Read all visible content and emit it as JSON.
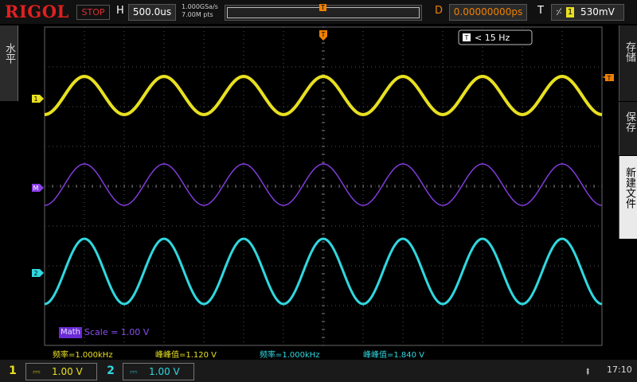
{
  "top": {
    "logo": "RIGOL",
    "run_state": "STOP",
    "h_label": "H",
    "timebase": "500.0us",
    "sample_rate": "1.000GSa/s",
    "mem_depth": "7.00M pts",
    "trig_pos_marker": "T",
    "d_label": "D",
    "delay": "0.00000000ps",
    "t_label": "T",
    "trig_edge": "⸓",
    "trig_source": "1",
    "trig_level": "530mV"
  },
  "left_menu": {
    "label": "水平"
  },
  "right_menu": [
    {
      "label": "存储",
      "active": false
    },
    {
      "label": "保存",
      "active": false
    },
    {
      "label": "新建文件",
      "active": true
    }
  ],
  "screen": {
    "trig_marker_top": "T",
    "freq_badge": {
      "icon": "T",
      "text": "< 15 Hz"
    },
    "trig_level_marker": "T",
    "ch1_marker": "1",
    "math_marker": "M",
    "ch2_marker": "2",
    "math_label": "Math",
    "math_scale": "Scale = 1.00 V"
  },
  "measurements": [
    {
      "text": "频率=1.000kHz",
      "color": "#e8e020"
    },
    {
      "text": "峰峰值=1.120 V",
      "color": "#e8e020"
    },
    {
      "text": "频率=1.000kHz",
      "color": "#30d8e0"
    },
    {
      "text": "峰峰值=1.840 V",
      "color": "#30d8e0"
    }
  ],
  "bottom": {
    "ch1": {
      "num": "1",
      "coupling": "⎓",
      "scale": "1.00 V",
      "color": "#e8e020"
    },
    "ch2": {
      "num": "2",
      "coupling": "⎓",
      "scale": "1.00 V",
      "color": "#30d8e0"
    },
    "usb_icon": "usb-icon",
    "time": "17:10"
  },
  "colors": {
    "ch1": "#e8e020",
    "ch2": "#30d8e0",
    "math": "#8a3ee8",
    "trigger": "#f08000",
    "logo": "#e02020"
  }
}
